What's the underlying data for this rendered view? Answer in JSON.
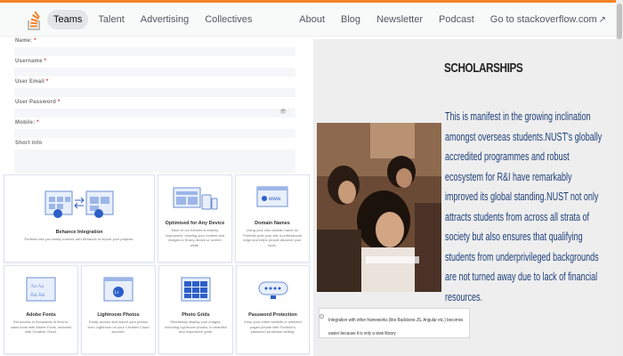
{
  "nav": {
    "left": [
      "Teams",
      "Talent",
      "Advertising",
      "Collectives"
    ],
    "right": [
      "About",
      "Blog",
      "Newsletter",
      "Podcast",
      "Go to stackoverflow.com"
    ]
  },
  "form": {
    "fields": [
      {
        "label": "Name:",
        "req": "*"
      },
      {
        "label": "Username",
        "req": "*"
      },
      {
        "label": "User Email",
        "req": "*"
      },
      {
        "label": "User Password",
        "req": "*"
      },
      {
        "label": "Mobile:",
        "req": "*"
      },
      {
        "label": "Short info",
        "req": ""
      }
    ]
  },
  "features": [
    {
      "title": "Behance Integration",
      "desc": "Portfolio lets you easily connect with Behance to import your projects."
    },
    {
      "title": "Optimised for Any Device",
      "desc": "Each of our themes is entirely responsive, resizing your content and images to fit any device or screen width."
    },
    {
      "title": "Domain Names",
      "desc": "Using your own domain name on Portfolio puts your site a professional edge and helps people discover your work."
    },
    {
      "title": "Adobe Fonts",
      "desc": "Get access to thousands of best-in-class fonts with Adobe Fonts, included with Creative Cloud."
    },
    {
      "title": "Lightroom Photos",
      "desc": "Easily access and import your photos from Lightroom on your Creative Cloud account."
    },
    {
      "title": "Photo Grids",
      "desc": "Effortlessly display your images, including Lightroom photos, in beautiful and responsive grids."
    },
    {
      "title": "Password Protection",
      "desc": "Keep your entire website or selected pages private with Portfolio's password protection setting."
    }
  ],
  "scholarship": {
    "title": "SCHOLARSHIPS",
    "body": "This is manifest in the growing inclination amongst overseas students.NUST's globally accredited programmes and robust ecosystem for R&I have remarkably improved its global standing.NUST not only attracts students from across all strata of society but also ensures that qualifying students from underprivileged backgrounds are not turned away due to lack of financial resources.",
    "alert": "Integration with other frameworks (like Backbone.JS, Angular etc.) becomes easier because it is only a view library"
  },
  "icons": {
    "external": "external-link-icon",
    "eye": "eye-icon"
  }
}
